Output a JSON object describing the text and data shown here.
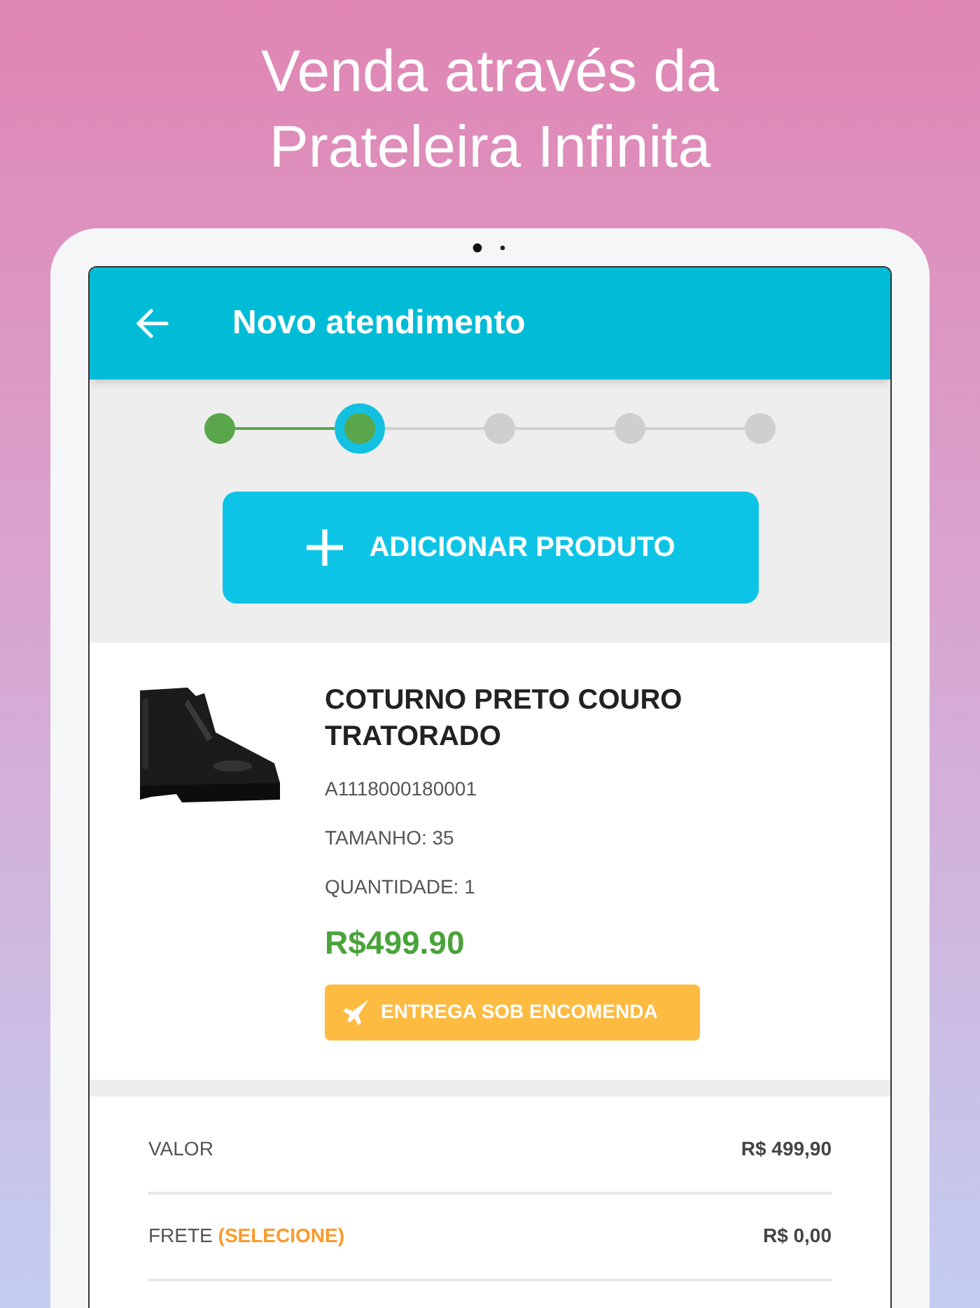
{
  "headline": [
    "Venda através da",
    "Prateleira Infinita"
  ],
  "app_bar": {
    "title": "Novo atendimento"
  },
  "steps": [
    {
      "completed": true,
      "selected": false
    },
    {
      "completed": true,
      "selected": true
    },
    {
      "completed": false,
      "selected": false
    },
    {
      "completed": false,
      "selected": false
    },
    {
      "completed": false,
      "selected": false
    }
  ],
  "add_button": {
    "label": "ADICIONAR PRODUTO"
  },
  "product": {
    "name": "COTURNO PRETO COURO TRATORADO",
    "sku": "A1118000180001",
    "size": "TAMANHO: 35",
    "quantity": "QUANTIDADE: 1",
    "price": "R$499.90",
    "delivery_badge": "ENTREGA SOB ENCOMENDA"
  },
  "summary": [
    {
      "label": "VALOR",
      "value": "R$ 499,90"
    },
    {
      "label": "FRETE",
      "action": "(SELECIONE)",
      "value": "R$ 0,00"
    }
  ]
}
